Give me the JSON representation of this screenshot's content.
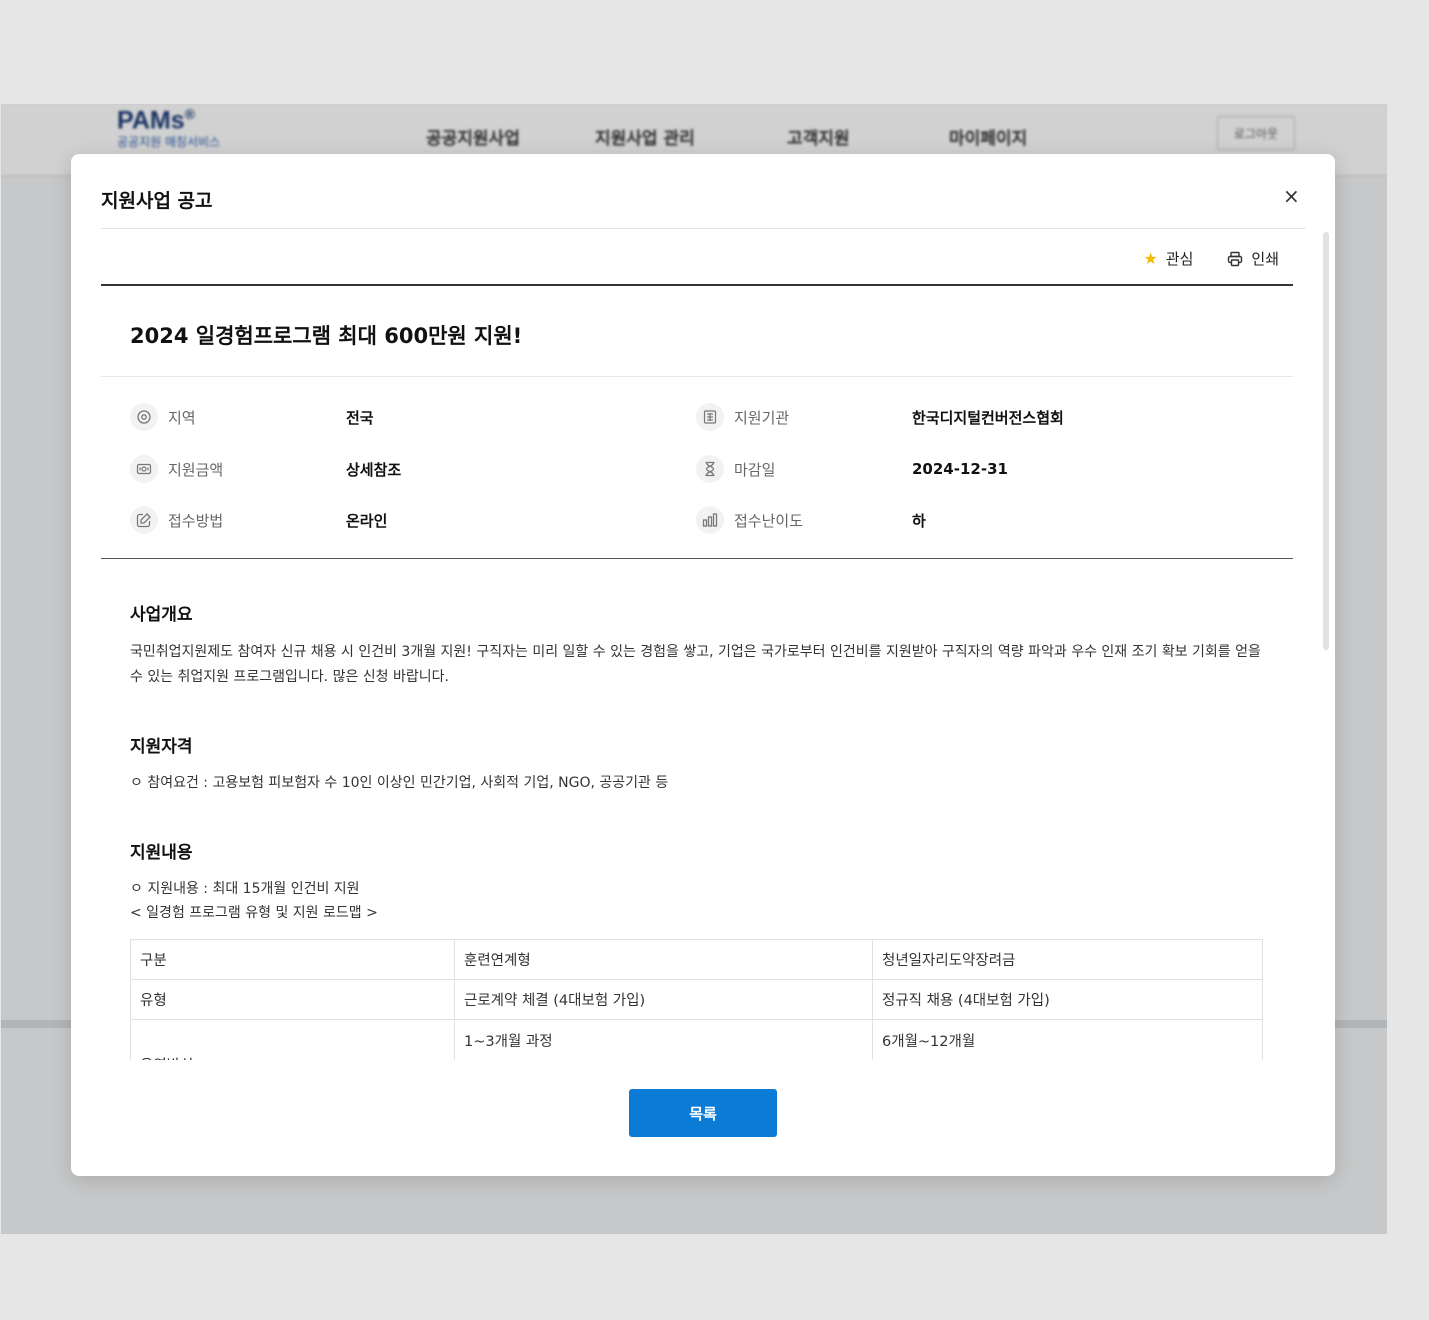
{
  "app": {
    "logo": "PAMs",
    "logo_mark": "®",
    "logo_sub": "공공지원 매칭서비스",
    "nav": [
      "공공지원사업",
      "지원사업 관리",
      "고객지원",
      "마이페이지"
    ],
    "logout": "로그아웃"
  },
  "modal": {
    "title": "지원사업 공고",
    "close": "×",
    "actions": {
      "favorite": "관심",
      "print": "인쇄"
    },
    "post_title": "2024 일경험프로그램 최대 600만원 지원!",
    "info": {
      "region_label": "지역",
      "region_value": "전국",
      "agency_label": "지원기관",
      "agency_value": "한국디지털컨버전스협회",
      "amount_label": "지원금액",
      "amount_value": "상세참조",
      "deadline_label": "마감일",
      "deadline_value": "2024-12-31",
      "method_label": "접수방법",
      "method_value": "온라인",
      "difficulty_label": "접수난이도",
      "difficulty_value": "하"
    },
    "overview": {
      "title": "사업개요",
      "text": "국민취업지원제도 참여자 신규 채용 시 인건비 3개월 지원! 구직자는 미리 일할 수 있는 경험을 쌓고, 기업은 국가로부터 인건비를 지원받아 구직자의 역량 파악과 우수 인재 조기 확보 기회를 얻을 수 있는 취업지원 프로그램입니다. 많은 신청 바랍니다."
    },
    "eligibility": {
      "title": "지원자격",
      "text": "ㅇ 참여요건 : 고용보험 피보험자 수 10인 이상인 민간기업, 사회적 기업, NGO, 공공기관 등"
    },
    "content": {
      "title": "지원내용",
      "line1": "ㅇ 지원내용 : 최대 15개월 인건비 지원",
      "line2": "< 일경험 프로그램 유형 및 지원 로드맵 >",
      "table": [
        [
          "구분",
          "훈련연계형",
          "청년일자리도약장려금"
        ],
        [
          "유형",
          "근로계약 체결 (4대보험 가입)",
          "정규직 채용 (4대보험 가입)"
        ],
        [
          "운영방식",
          "1~3개월 과정",
          "6개월~12개월"
        ]
      ]
    },
    "list_button": "목록"
  }
}
